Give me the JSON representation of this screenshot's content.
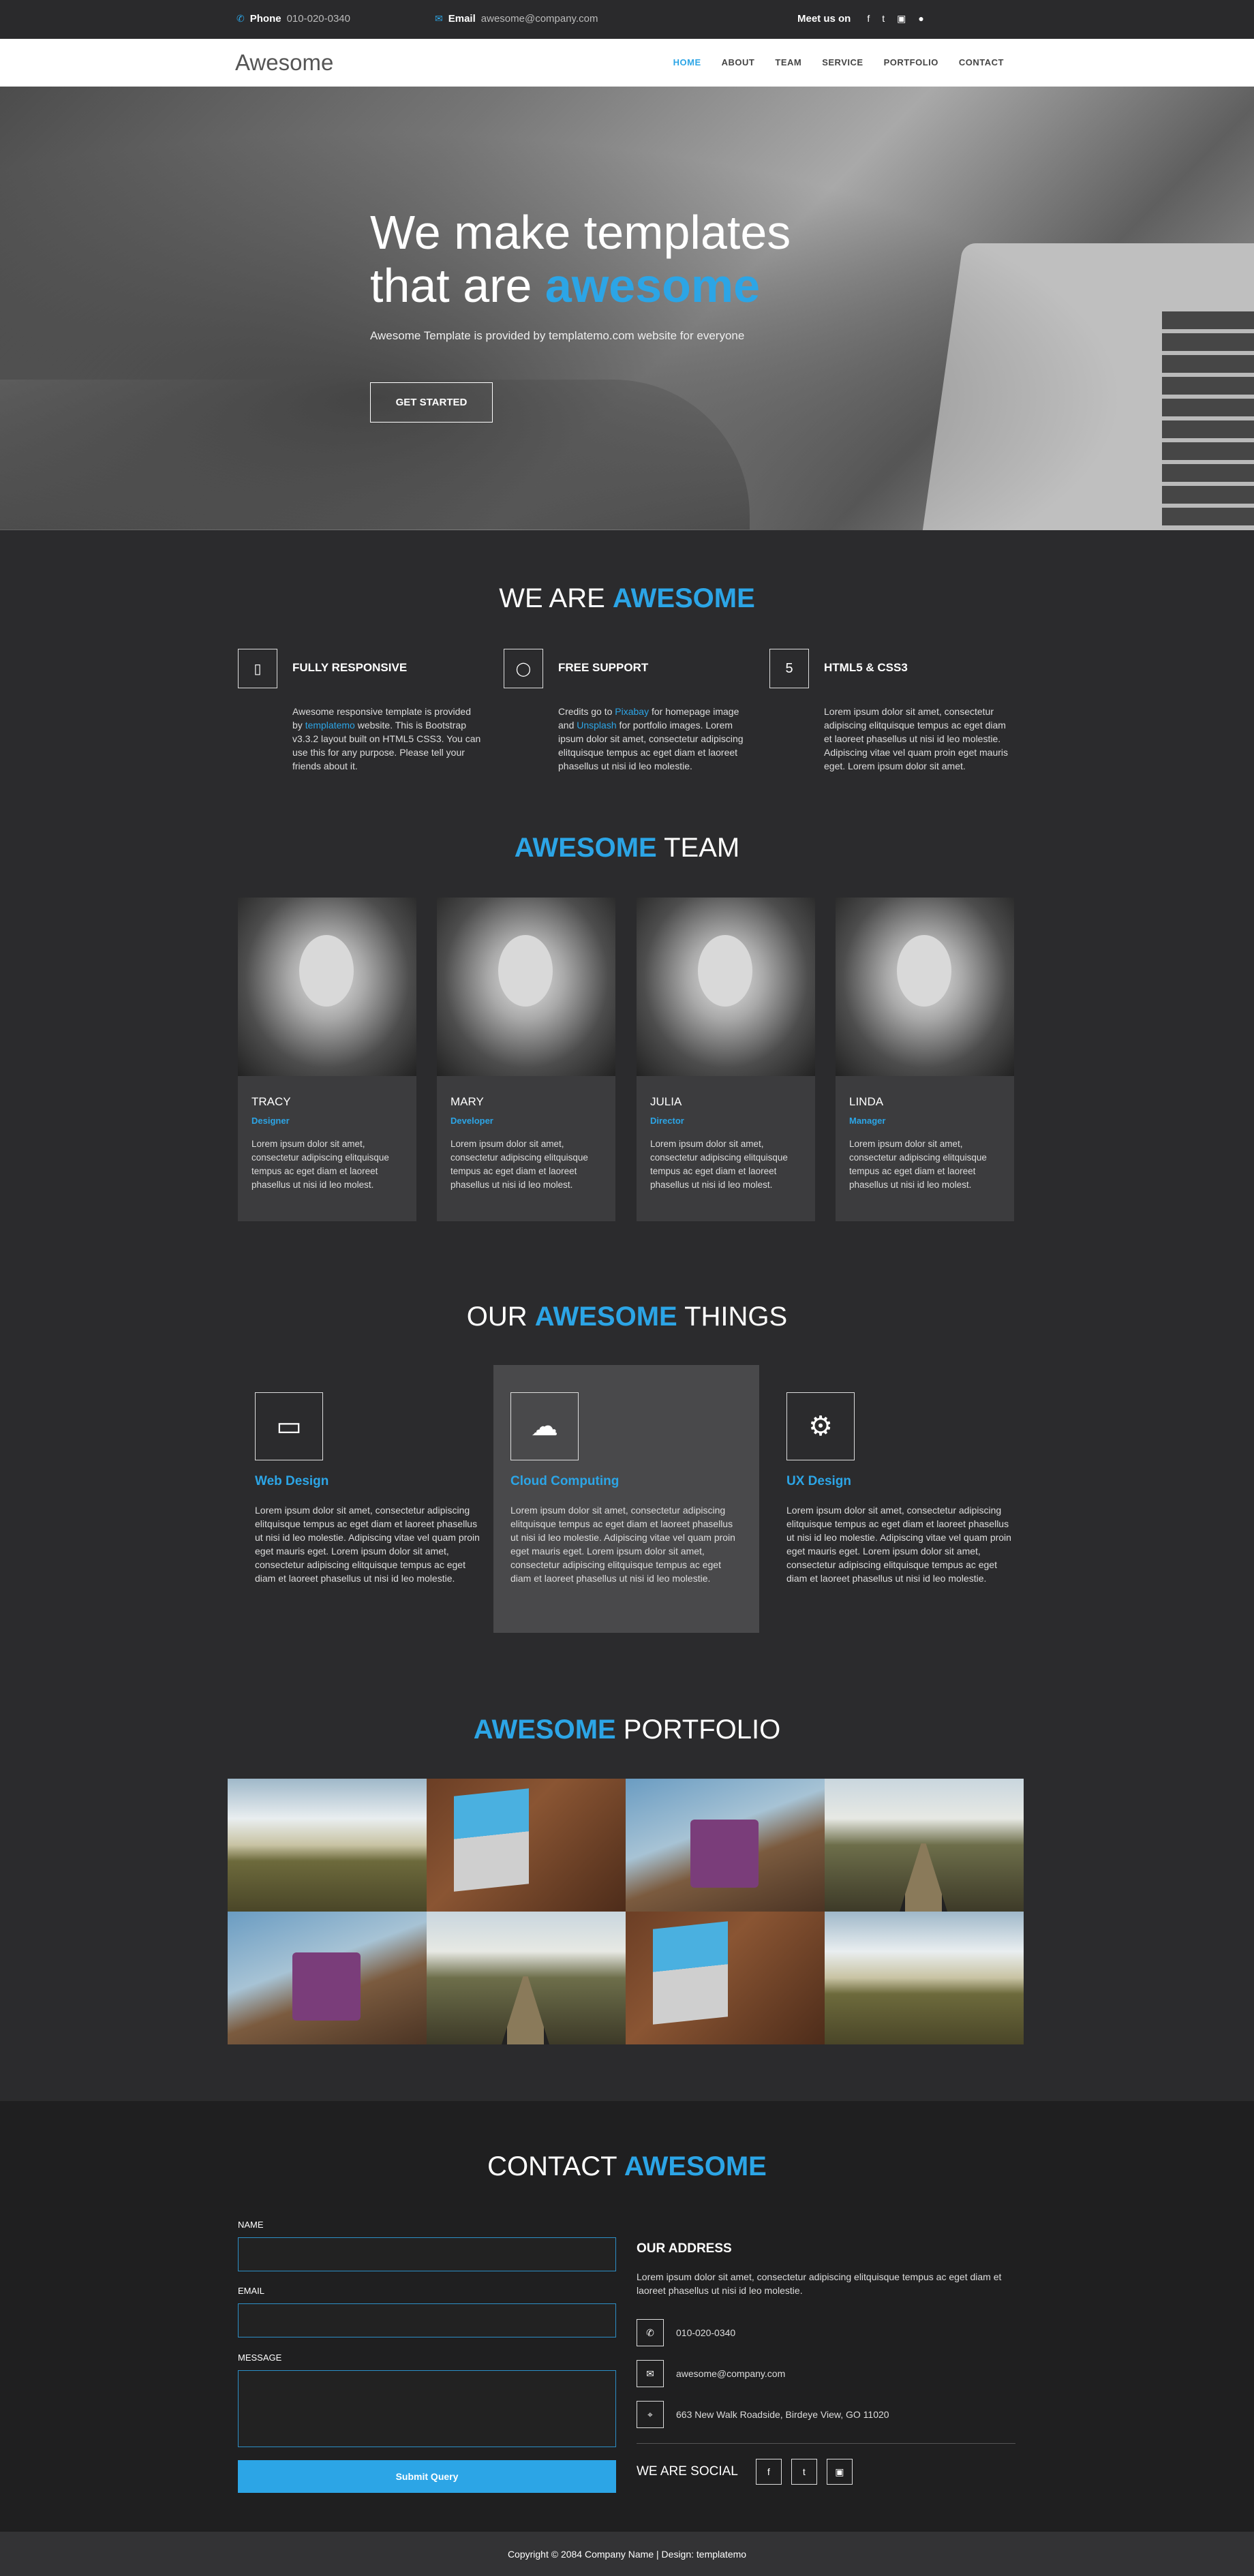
{
  "topbar": {
    "phone_label": "Phone",
    "phone_value": "010-020-0340",
    "email_label": "Email",
    "email_value": "awesome@company.com",
    "meet_label": "Meet us on",
    "social_icons": [
      "facebook-icon",
      "twitter-icon",
      "instagram-icon",
      "apple-icon"
    ]
  },
  "nav": {
    "brand": "Awesome",
    "items": [
      "HOME",
      "ABOUT",
      "TEAM",
      "SERVICE",
      "PORTFOLIO",
      "CONTACT"
    ],
    "active": "HOME"
  },
  "hero": {
    "line1": "We make templates",
    "line2_pre": "that are ",
    "line2_em": "awesome",
    "subtitle": "Awesome Template is provided by templatemo.com website for everyone",
    "cta": "GET STARTED"
  },
  "about": {
    "title_pre": "WE ARE ",
    "title_em": "AWESOME",
    "features": [
      {
        "icon": "mobile-icon",
        "title": "FULLY RESPONSIVE",
        "p1": "Awesome responsive template is provided by ",
        "link": "templatemo",
        "p2": " website. This is Bootstrap v3.3.2 layout built on HTML5 CSS3. You can use this for any purpose. Please tell your friends about it."
      },
      {
        "icon": "chat-bubble-icon",
        "title": "FREE SUPPORT",
        "p1": "Credits go to ",
        "link": "Pixabay",
        "p2": " for homepage image and ",
        "link2": "Unsplash",
        "p3": " for portfolio images. Lorem ipsum dolor sit amet, consectetur adipiscing elitquisque tempus ac eget diam et laoreet phasellus ut nisi id leo molestie."
      },
      {
        "icon": "html5-icon",
        "title": "HTML5 & CSS3",
        "p1": "Lorem ipsum dolor sit amet, consectetur adipiscing elitquisque tempus ac eget diam et laoreet phasellus ut nisi id leo molestie. Adipiscing vitae vel quam proin eget mauris eget. Lorem ipsum dolor sit amet."
      }
    ]
  },
  "team": {
    "title_em": "AWESOME",
    "title_post": " TEAM",
    "members": [
      {
        "name": "TRACY",
        "role": "Designer",
        "desc": "Lorem ipsum dolor sit amet, consectetur adipiscing elitquisque tempus ac eget diam et laoreet phasellus ut nisi id leo molest."
      },
      {
        "name": "MARY",
        "role": "Developer",
        "desc": "Lorem ipsum dolor sit amet, consectetur adipiscing elitquisque tempus ac eget diam et laoreet phasellus ut nisi id leo molest."
      },
      {
        "name": "JULIA",
        "role": "Director",
        "desc": "Lorem ipsum dolor sit amet, consectetur adipiscing elitquisque tempus ac eget diam et laoreet phasellus ut nisi id leo molest."
      },
      {
        "name": "LINDA",
        "role": "Manager",
        "desc": "Lorem ipsum dolor sit amet, consectetur adipiscing elitquisque tempus ac eget diam et laoreet phasellus ut nisi id leo molest."
      }
    ]
  },
  "things": {
    "title_pre": "OUR ",
    "title_em": "AWESOME",
    "title_post": " THINGS",
    "items": [
      {
        "icon": "laptop-icon",
        "title": "Web Design",
        "desc": "Lorem ipsum dolor sit amet, consectetur adipiscing elitquisque tempus ac eget diam et laoreet phasellus ut nisi id leo molestie. Adipiscing vitae vel quam proin eget mauris eget. Lorem ipsum dolor sit amet, consectetur adipiscing elitquisque tempus ac eget diam et laoreet phasellus ut nisi id leo molestie."
      },
      {
        "icon": "cloud-icon",
        "title": "Cloud Computing",
        "desc": "Lorem ipsum dolor sit amet, consectetur adipiscing elitquisque tempus ac eget diam et laoreet phasellus ut nisi id leo molestie. Adipiscing vitae vel quam proin eget mauris eget. Lorem ipsum dolor sit amet, consectetur adipiscing elitquisque tempus ac eget diam et laoreet phasellus ut nisi id leo molestie."
      },
      {
        "icon": "gear-icon",
        "title": "UX Design",
        "desc": "Lorem ipsum dolor sit amet, consectetur adipiscing elitquisque tempus ac eget diam et laoreet phasellus ut nisi id leo molestie. Adipiscing vitae vel quam proin eget mauris eget. Lorem ipsum dolor sit amet, consectetur adipiscing elitquisque tempus ac eget diam et laoreet phasellus ut nisi id leo molestie."
      }
    ]
  },
  "portfolio": {
    "title_em": "AWESOME",
    "title_post": " PORTFOLIO",
    "tiles": [
      "landscape",
      "laptop",
      "cup",
      "rail",
      "cup",
      "rail",
      "laptop",
      "landscape"
    ]
  },
  "contact": {
    "title_pre": "CONTACT ",
    "title_em": "AWESOME",
    "name_label": "NAME",
    "email_label": "EMAIL",
    "message_label": "MESSAGE",
    "submit": "Submit Query",
    "address_title": "OUR ADDRESS",
    "address_text": "Lorem ipsum dolor sit amet, consectetur adipiscing elitquisque tempus ac eget diam et laoreet phasellus ut nisi id leo molestie.",
    "phone": "010-020-0340",
    "email": "awesome@company.com",
    "location": "663 New Walk Roadside, Birdeye View, GO 11020",
    "social_label": "WE ARE SOCIAL"
  },
  "footer": {
    "copyright": "Copyright © 2084 Company Name | Design: templatemo"
  },
  "colors": {
    "accent": "#2ca5e6",
    "background": "#2b2b2d",
    "footer": "#333335"
  }
}
